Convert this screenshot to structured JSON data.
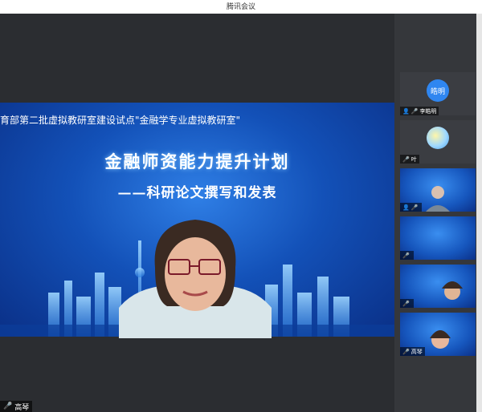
{
  "window": {
    "title": "腾讯会议"
  },
  "slide": {
    "header": "育部第二批虚拟教研室建设试点\"金融学专业虚拟教研室\"",
    "title": "金融师资能力提升计划",
    "subtitle": "——科研论文撰写和发表"
  },
  "main_speaker": {
    "name": "高琴"
  },
  "participants": [
    {
      "avatar_text": "皓明",
      "name": "李皓明"
    },
    {
      "avatar_text": "",
      "name": "叶"
    },
    {
      "avatar_text": "",
      "name": ""
    },
    {
      "avatar_text": "",
      "name": ""
    },
    {
      "avatar_text": "",
      "name": ""
    },
    {
      "avatar_text": "",
      "name": "高琴"
    }
  ],
  "colors": {
    "slide_blue": "#1351b8",
    "avatar_blue": "#2f86f0",
    "sidebar_bg": "#35373b",
    "main_bg": "#2b2d31"
  }
}
